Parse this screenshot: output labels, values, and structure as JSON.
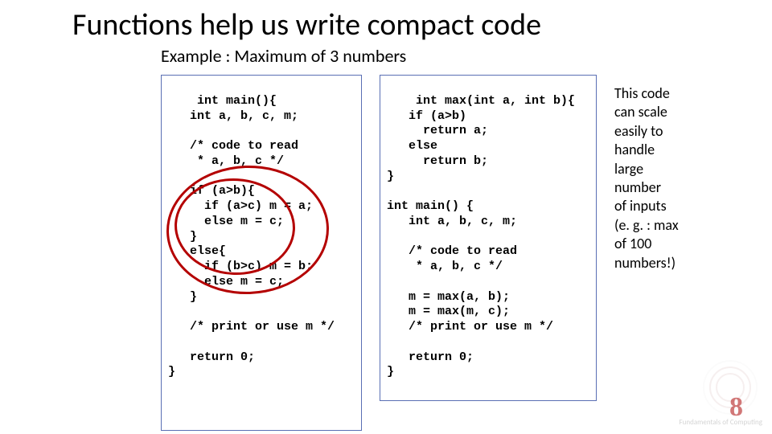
{
  "title": "Functions help us write compact code",
  "subtitle": "Example : Maximum of 3 numbers",
  "code_left": "int main(){\n   int a, b, c, m;\n\n   /* code to read\n    * a, b, c */\n\n   if (a>b){\n     if (a>c) m = a;\n     else m = c;\n   }\n   else{\n     if (b>c) m = b;\n     else m = c;\n   }\n\n   /* print or use m */\n\n   return 0;\n}",
  "code_right": "int max(int a, int b){\n   if (a>b)\n     return a;\n   else\n     return b;\n}\n\nint main() {\n   int a, b, c, m;\n\n   /* code to read\n    * a, b, c */\n\n   m = max(a, b);\n   m = max(m, c);\n   /* print or use m */\n\n   return 0;\n}",
  "sidenote": "This code\ncan scale\neasily to\nhandle\nlarge\nnumber\nof inputs\n(e. g. : max\nof 100\nnumbers!)",
  "page_number": "8",
  "logo_caption": "Fundamentals\nof Computing"
}
